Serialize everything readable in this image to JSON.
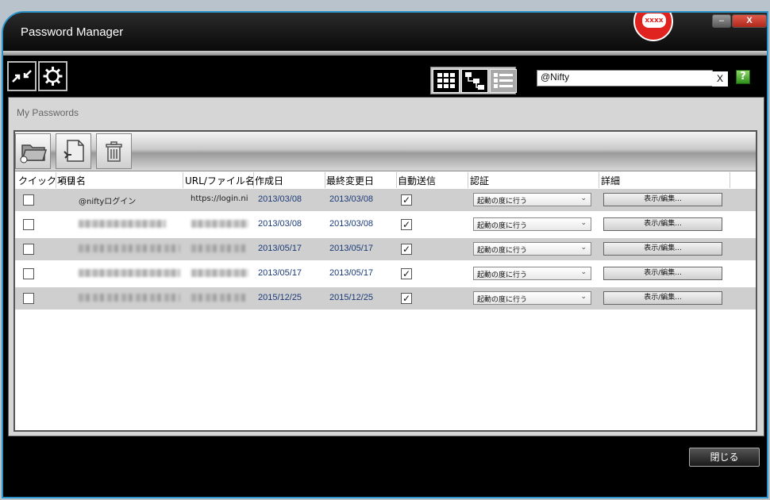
{
  "window": {
    "title": "Password Manager",
    "badge_text": "xxxx",
    "minimize_label": "–",
    "close_label": "X"
  },
  "toolbar": {
    "collapse_icon": "collapse-arrows-icon",
    "settings_icon": "gear-icon",
    "view_modes": [
      "grid-view-icon",
      "tree-view-icon",
      "list-view-icon"
    ],
    "active_view": "list-view-icon",
    "search": {
      "value": "@Nifty",
      "clear_label": "X"
    },
    "help_label": "?"
  },
  "main": {
    "section_title": "My Passwords",
    "actions": [
      "open-folder-icon",
      "new-entry-icon",
      "trash-icon"
    ],
    "columns": [
      "クイック・リ",
      "項目名",
      "URL/ファイル名",
      "作成日",
      "最終変更日",
      "自動送信",
      "認証",
      "詳細"
    ],
    "rows": [
      {
        "quick": false,
        "name": "@niftyログイン",
        "url": "https://login.ni",
        "created": "2013/03/08",
        "modified": "2013/03/08",
        "autosend": true,
        "auth": "起動の度に行う",
        "detail": "表示/編集..."
      },
      {
        "quick": false,
        "name": "",
        "url": "",
        "created": "2013/03/08",
        "modified": "2013/03/08",
        "autosend": true,
        "auth": "起動の度に行う",
        "detail": "表示/編集..."
      },
      {
        "quick": false,
        "name": "",
        "url": "",
        "created": "2013/05/17",
        "modified": "2013/05/17",
        "autosend": true,
        "auth": "起動の度に行う",
        "detail": "表示/編集..."
      },
      {
        "quick": false,
        "name": "",
        "url": "",
        "created": "2013/05/17",
        "modified": "2013/05/17",
        "autosend": true,
        "auth": "起動の度に行う",
        "detail": "表示/編集..."
      },
      {
        "quick": false,
        "name": "",
        "url": "",
        "created": "2015/12/25",
        "modified": "2015/12/25",
        "autosend": true,
        "auth": "起動の度に行う",
        "detail": "表示/編集..."
      }
    ]
  },
  "footer": {
    "close_label": "閉じる"
  },
  "colors": {
    "accent": "#2a93c9",
    "badge": "#e12320",
    "date_text": "#1a3a78"
  }
}
